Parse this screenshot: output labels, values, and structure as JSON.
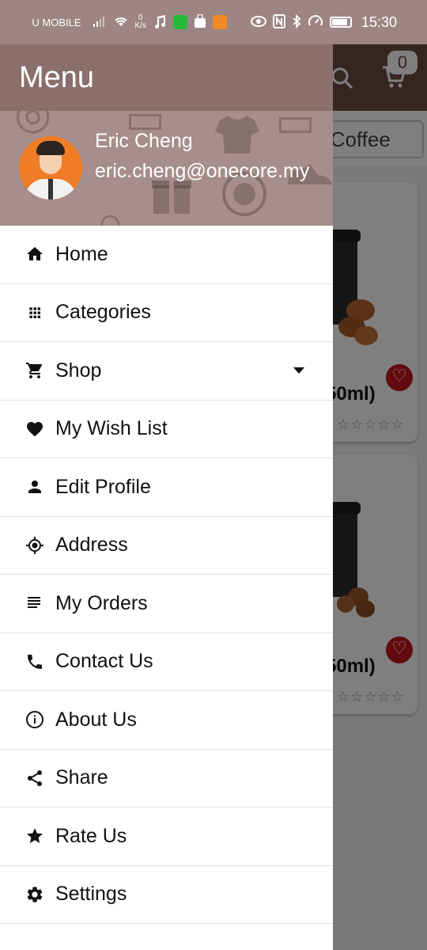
{
  "status_bar": {
    "carrier": "U MOBILE",
    "net_speed_value": "0",
    "net_speed_unit": "K/s",
    "time": "15:30"
  },
  "background_app": {
    "cart_count": "0",
    "tab_label": "d Coffee",
    "products": [
      {
        "name": "50ml)",
        "rating_stars": "☆☆☆☆☆"
      },
      {
        "name": "50ml)",
        "rating_stars": "☆☆☆☆☆"
      }
    ]
  },
  "drawer": {
    "title": "Menu",
    "user": {
      "name": "Eric Cheng",
      "email": "eric.cheng@onecore.my"
    },
    "items": [
      {
        "label": "Home",
        "icon": "home-icon"
      },
      {
        "label": "Categories",
        "icon": "grid-icon"
      },
      {
        "label": "Shop",
        "icon": "cart-icon"
      },
      {
        "label": "My Wish List",
        "icon": "heart-icon"
      },
      {
        "label": "Edit Profile",
        "icon": "person-icon"
      },
      {
        "label": "Address",
        "icon": "location-icon"
      },
      {
        "label": "My Orders",
        "icon": "list-icon"
      },
      {
        "label": "Contact Us",
        "icon": "phone-icon"
      },
      {
        "label": "About Us",
        "icon": "info-icon"
      },
      {
        "label": "Share",
        "icon": "share-icon"
      },
      {
        "label": "Rate Us",
        "icon": "star-icon"
      },
      {
        "label": "Settings",
        "icon": "gear-icon"
      }
    ]
  },
  "colors": {
    "status_bar": "#9c8583",
    "drawer_title_bar": "#8a6f6b",
    "drawer_header": "#a58e8b",
    "app_toolbar": "#6d4c44",
    "fav_button": "#c4141c"
  }
}
